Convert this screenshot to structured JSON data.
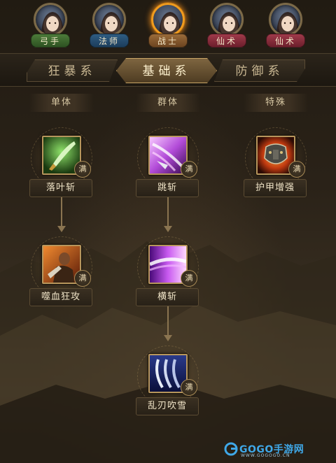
{
  "characters": [
    {
      "label": "弓手",
      "color": "green",
      "active": false
    },
    {
      "label": "法师",
      "color": "blue",
      "active": false
    },
    {
      "label": "战士",
      "color": "brown",
      "active": true
    },
    {
      "label": "仙术",
      "color": "red",
      "active": false
    },
    {
      "label": "仙术",
      "color": "red",
      "active": false
    }
  ],
  "tabs": [
    {
      "label": "狂暴系",
      "active": false
    },
    {
      "label": "基础系",
      "active": true
    },
    {
      "label": "防御系",
      "active": false
    }
  ],
  "columns": [
    "单体",
    "群体",
    "特殊"
  ],
  "skills": {
    "luoye": {
      "name": "落叶斩",
      "badge": "满",
      "icon": "green-blade-icon"
    },
    "tiaozhan": {
      "name": "跳斩",
      "badge": "满",
      "icon": "purple-slash-icon"
    },
    "hujia": {
      "name": "护甲增强",
      "badge": "满",
      "icon": "armor-icon"
    },
    "shixue": {
      "name": "噬血狂攻",
      "badge": "满",
      "icon": "berserker-icon"
    },
    "hengzhan": {
      "name": "横斩",
      "badge": "满",
      "icon": "horizontal-slash-icon"
    },
    "luanren": {
      "name": "乱刃吹雪",
      "badge": "满",
      "icon": "blades-icon"
    }
  },
  "watermark": {
    "brand": "GOGO手游网",
    "sub": "WWW.GOGOGO.CN"
  }
}
